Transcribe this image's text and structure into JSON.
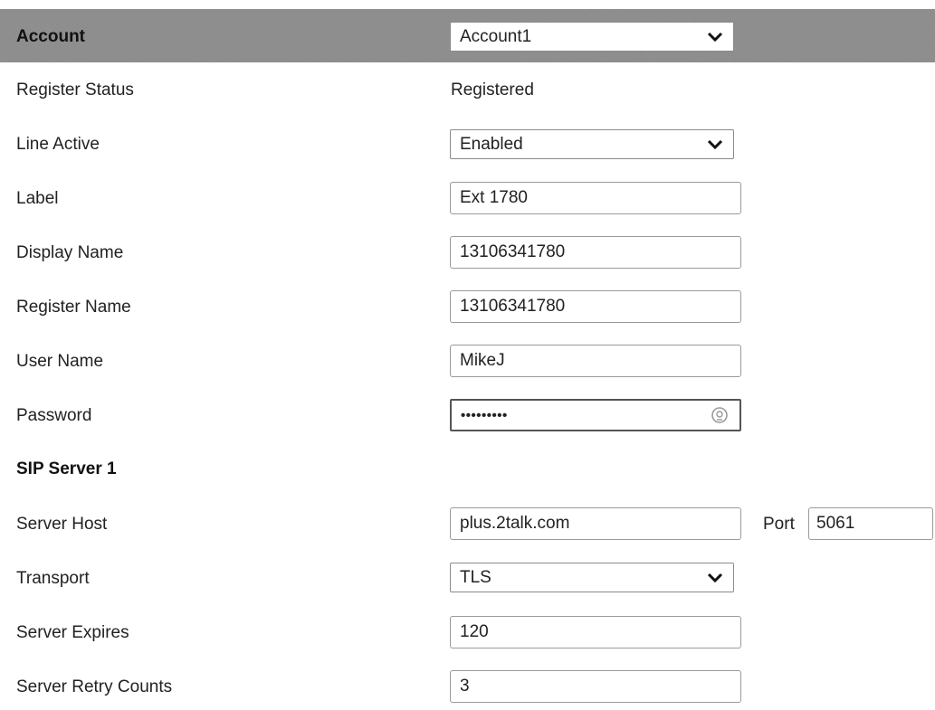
{
  "account": {
    "label": "Account",
    "selected": "Account1",
    "options": [
      "Account1"
    ]
  },
  "rows": {
    "register_status": {
      "label": "Register Status",
      "value": "Registered"
    },
    "line_active": {
      "label": "Line Active",
      "value": "Enabled"
    },
    "label": {
      "label": "Label",
      "value": "Ext 1780"
    },
    "display_name": {
      "label": "Display Name",
      "value": "13106341780"
    },
    "register_name": {
      "label": "Register Name",
      "value": "13106341780"
    },
    "user_name": {
      "label": "User Name",
      "value": "MikeJ"
    },
    "password": {
      "label": "Password",
      "masked": "•••••••••"
    }
  },
  "sip_server_1": {
    "heading": "SIP Server 1",
    "server_host": {
      "label": "Server Host",
      "value": "plus.2talk.com"
    },
    "port": {
      "label": "Port",
      "value": "5061"
    },
    "transport": {
      "label": "Transport",
      "value": "TLS"
    },
    "server_expires": {
      "label": "Server Expires",
      "value": "120"
    },
    "server_retry_counts": {
      "label": "Server Retry Counts",
      "value": "3"
    }
  },
  "icons": {
    "select_arrow": "chevron-down-icon",
    "password_reveal": "password-reveal-icon"
  },
  "colors": {
    "header_band": "#8c8c8c",
    "field_border": "#9a9a9a",
    "text": "#222222"
  }
}
